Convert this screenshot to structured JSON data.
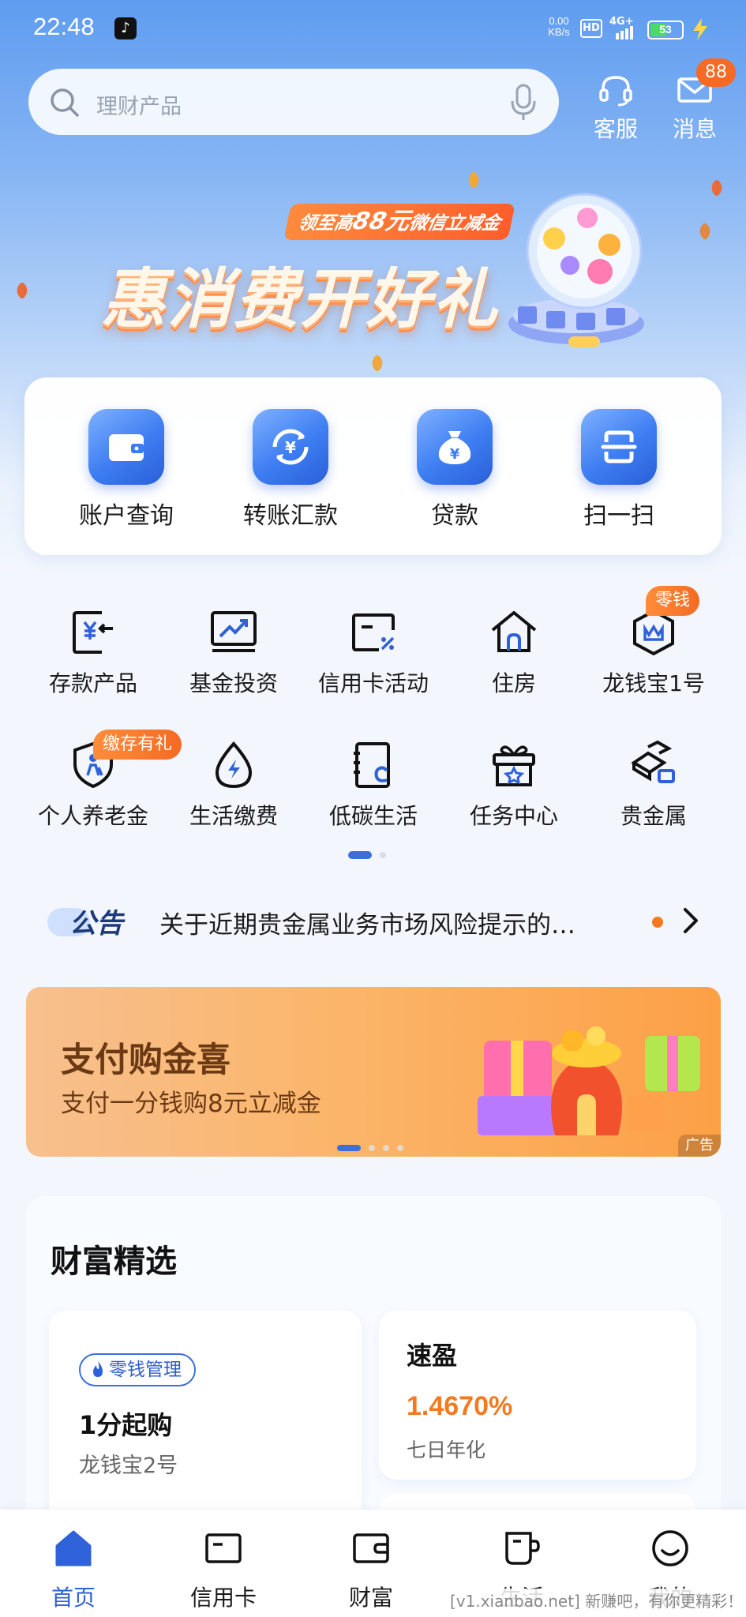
{
  "status_bar": {
    "time": "22:48",
    "net_speed_value": "0.00",
    "net_speed_unit": "KB/s",
    "hd": "HD",
    "network": "4G+",
    "battery": "53",
    "battery_level": 0.53
  },
  "search": {
    "placeholder": "理财产品"
  },
  "top_actions": {
    "service": "客服",
    "messages": "消息",
    "message_badge": "88"
  },
  "banner": {
    "pill_prefix": "领至高",
    "pill_amount": "88元",
    "pill_suffix": "微信立减金",
    "title": "惠消费开好礼"
  },
  "quick_actions": [
    "账户查询",
    "转账汇款",
    "贷款",
    "扫一扫"
  ],
  "grid": {
    "row1": [
      "存款产品",
      "基金投资",
      "信用卡活动",
      "住房",
      "龙钱宝1号"
    ],
    "row2": [
      "个人养老金",
      "生活缴费",
      "低碳生活",
      "任务中心",
      "贵金属"
    ],
    "tag_change": "零钱",
    "tag_pension": "缴存有礼"
  },
  "notice": {
    "label": "公告",
    "text": "关于近期贵金属业务市场风险提示的…"
  },
  "promo": {
    "title": "支付购金喜",
    "subtitle": "支付一分钱购8元立减金",
    "ad": "广告"
  },
  "wealth": {
    "title": "财富精选",
    "left": {
      "tag": "零钱管理",
      "amount": "1分起购",
      "product": "龙钱宝2号"
    },
    "right": {
      "name": "速盈",
      "rate": "1.4670%",
      "rate_label": "七日年化"
    }
  },
  "tabs": [
    "首页",
    "信用卡",
    "财富",
    "生活",
    "我的"
  ],
  "watermark": "[v1.xianbao.net] 新赚吧，有你更精彩！",
  "colors": {
    "accent": "#2f62d8",
    "orange": "#f47a20",
    "brand_blue": "#3d7df2"
  }
}
